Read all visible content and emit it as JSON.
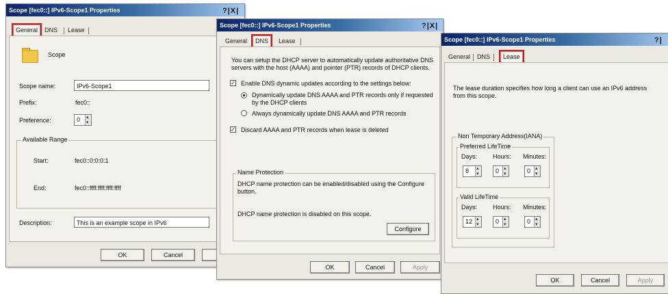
{
  "dialog1": {
    "title": "Scope [fec0::] IPv6-Scope1 Properties",
    "title_buttons": "?|X|",
    "tabs": [
      "General",
      "DNS",
      "Lease"
    ],
    "scope_header": "Scope",
    "scope_name_label": "Scope name:",
    "scope_name_value": "IPv6-Scope1",
    "prefix_label": "Prefix:",
    "prefix_value": "fec0::",
    "preference_label": "Preference:",
    "preference_value": "0",
    "available_range_label": "Available Range",
    "start_label": "Start:",
    "start_value": "fec0::0:0:0:1",
    "end_label": "End:",
    "end_value": "fec0::ffff:ffff:ffff:ffff",
    "description_label": "Description:",
    "description_value": "This is an example scope in IPv6",
    "ok": "OK",
    "cancel": "Cancel"
  },
  "dialog2": {
    "title": "Scope [fec0::] IPv6-Scope1 Properties",
    "title_buttons": "?|X|",
    "tabs": [
      "General",
      "DNS",
      "Lease"
    ],
    "intro": "You can setup the DHCP server to automatically update authoritative DNS servers with the host (AAAA) and pointer (PTR) records of DHCP clients.",
    "enable_dns": "Enable DNS dynamic updates according to the settings below:",
    "radio_requested": "Dynamically update DNS AAAA and PTR records only if requested by the DHCP clients",
    "radio_always": "Always dynamically update DNS AAAA and PTR records",
    "discard": "Discard AAAA and PTR records when lease is deleted",
    "name_protection_label": "Name Protection",
    "np_text1": "DHCP name protection can be enabled/disabled using the Configure button.",
    "np_text2": "DHCP name protection is disabled on this scope.",
    "configure": "Configure",
    "ok": "OK",
    "cancel": "Cancel",
    "apply": "Apply"
  },
  "dialog3": {
    "title": "Scope [fec0::] IPv6-Scope1 Properties",
    "title_buttons": "?|",
    "tabs": [
      "General",
      "DNS",
      "Lease"
    ],
    "intro": "The lease duration specifies how long a client can use an IPv6 address from this scope.",
    "na_label": "Non Temporary Address(IANA)",
    "preferred_label": "Preferred LifeTime",
    "valid_label": "Valid LifeTime",
    "days_label": "Days:",
    "hours_label": "Hours:",
    "minutes_label": "Minutes:",
    "preferred": {
      "days": "8",
      "hours": "0",
      "minutes": "0"
    },
    "valid": {
      "days": "12",
      "hours": "0",
      "minutes": "0"
    },
    "ok": "OK",
    "cancel": "Cancel",
    "apply": "Apply"
  },
  "colors": {
    "highlight": "#d01515",
    "titlebar": "#0a246a",
    "dialog_bg": "#ece9e2"
  }
}
